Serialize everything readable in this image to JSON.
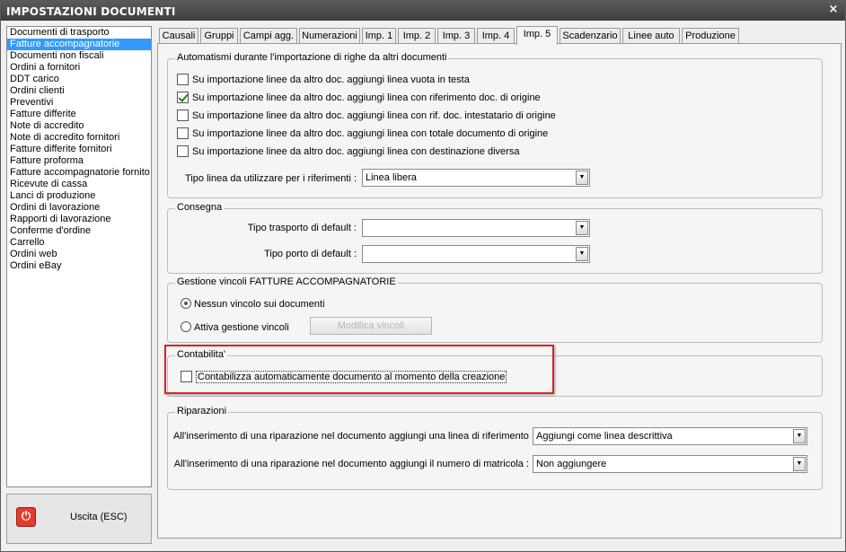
{
  "window": {
    "title": "IMPOSTAZIONI DOCUMENTI",
    "close_symbol": "×"
  },
  "sidebar": {
    "items": [
      {
        "label": "Documenti di trasporto",
        "selected": false
      },
      {
        "label": "Fatture accompagnatorie",
        "selected": true
      },
      {
        "label": "Documenti non fiscali",
        "selected": false
      },
      {
        "label": "Ordini a fornitori",
        "selected": false
      },
      {
        "label": "DDT carico",
        "selected": false
      },
      {
        "label": "Ordini clienti",
        "selected": false
      },
      {
        "label": "Preventivi",
        "selected": false
      },
      {
        "label": "Fatture differite",
        "selected": false
      },
      {
        "label": "Note di accredito",
        "selected": false
      },
      {
        "label": "Note di accredito fornitori",
        "selected": false
      },
      {
        "label": "Fatture differite fornitori",
        "selected": false
      },
      {
        "label": "Fatture proforma",
        "selected": false
      },
      {
        "label": "Fatture accompagnatorie fornito",
        "selected": false
      },
      {
        "label": "Ricevute di cassa",
        "selected": false
      },
      {
        "label": "Lanci di produzione",
        "selected": false
      },
      {
        "label": "Ordini di lavorazione",
        "selected": false
      },
      {
        "label": "Rapporti di lavorazione",
        "selected": false
      },
      {
        "label": "Conferme d'ordine",
        "selected": false
      },
      {
        "label": "Carrello",
        "selected": false
      },
      {
        "label": "Ordini web",
        "selected": false
      },
      {
        "label": "Ordini eBay",
        "selected": false
      }
    ]
  },
  "exit": {
    "label": "Uscita (ESC)",
    "icon": "power-icon",
    "icon_glyph": "⏻"
  },
  "tabs": [
    {
      "label": "Causali",
      "active": false
    },
    {
      "label": "Gruppi",
      "active": false
    },
    {
      "label": "Campi agg.",
      "active": false
    },
    {
      "label": "Numerazioni",
      "active": false
    },
    {
      "label": "Imp. 1",
      "active": false
    },
    {
      "label": "Imp. 2",
      "active": false
    },
    {
      "label": "Imp. 3",
      "active": false
    },
    {
      "label": "Imp. 4",
      "active": false
    },
    {
      "label": "Imp. 5",
      "active": true
    },
    {
      "label": "Scadenzario",
      "active": false
    },
    {
      "label": "Linee auto",
      "active": false
    },
    {
      "label": "Produzione",
      "active": false
    }
  ],
  "automatismi": {
    "title": "Automatismi durante l'importazione di righe da altri documenti",
    "options": [
      {
        "label": "Su importazione linee da altro doc. aggiungi linea vuota in testa",
        "checked": false
      },
      {
        "label": "Su importazione linee da altro doc. aggiungi linea con riferimento doc. di origine",
        "checked": true
      },
      {
        "label": "Su importazione linee da altro doc. aggiungi linea con rif. doc. intestatario di origine",
        "checked": false
      },
      {
        "label": "Su importazione linee da altro doc. aggiungi linea con totale documento di origine",
        "checked": false
      },
      {
        "label": "Su importazione linee da altro doc. aggiungi linea con destinazione diversa",
        "checked": false
      }
    ],
    "tipo_linea_label": "Tipo linea da utilizzare per i riferimenti :",
    "tipo_linea_value": "Linea libera"
  },
  "consegna": {
    "title": "Consegna",
    "trasporto_label": "Tipo trasporto di default :",
    "trasporto_value": "",
    "porto_label": "Tipo porto di default :",
    "porto_value": ""
  },
  "vincoli": {
    "title": "Gestione vincoli FATTURE ACCOMPAGNATORIE",
    "option_none": "Nessun vincolo sui documenti",
    "option_active": "Attiva gestione vincoli",
    "selected": "none",
    "modify_button": "Modifica vincoli"
  },
  "contabilita": {
    "title": "Contabilita'",
    "auto_label": "Contabilizza automaticamente documento al momento della creazione",
    "auto_checked": false
  },
  "riparazioni": {
    "title": "Riparazioni",
    "rif_label": "All'inserimento di una riparazione nel documento aggiungi una linea di riferimento :",
    "rif_value": "Aggiungi come linea descrittiva",
    "matricola_label": "All'inserimento di una riparazione nel documento aggiungi il numero di matricola :",
    "matricola_value": "Non aggiungere"
  },
  "colors": {
    "selection": "#3399ff",
    "highlight": "#e02020",
    "check": "#1a7f1a"
  }
}
